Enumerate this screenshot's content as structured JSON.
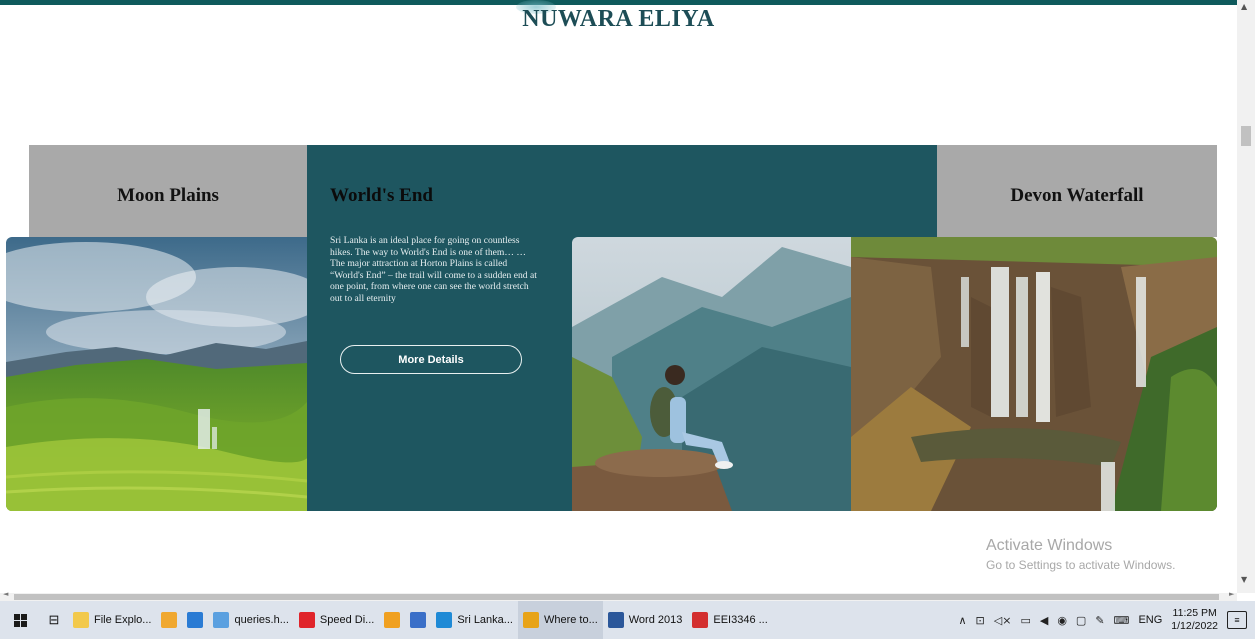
{
  "site": {
    "title": "NUWARA ELIYA"
  },
  "cards": {
    "left_heading": "Moon Plains",
    "right_heading": "Devon Waterfall"
  },
  "feature": {
    "title": "World's End",
    "description": "Sri Lanka is an ideal place for going on countless hikes. The way to World's End is one of them… … The major attraction at Horton Plains is called “World's End” – the trail will come to a sudden end at one point, from where one can see the world stretch out to all eternity",
    "button_label": "More Details"
  },
  "watermark": {
    "line1": "Activate Windows",
    "line2": "Go to Settings to activate Windows."
  },
  "taskbar": {
    "items": [
      {
        "label": "File Explo...",
        "icon": "folder-icon",
        "color": "#f2c94c"
      },
      {
        "label": "",
        "icon": "store-icon",
        "color": "#f0a830"
      },
      {
        "label": "",
        "icon": "mail-icon",
        "color": "#2a7bd4"
      },
      {
        "label": "queries.h...",
        "icon": "notepad-icon",
        "color": "#5aa0e0"
      },
      {
        "label": "Speed Di...",
        "icon": "opera-icon",
        "color": "#e0242b"
      },
      {
        "label": "",
        "icon": "app-icon",
        "color": "#f0a020"
      },
      {
        "label": "",
        "icon": "remote-icon",
        "color": "#3a6fc8"
      },
      {
        "label": "Sri Lanka...",
        "icon": "vscode-icon",
        "color": "#1f8ad6"
      },
      {
        "label": "Where to...",
        "icon": "chrome-icon",
        "color": "#e8a317"
      },
      {
        "label": "Word 2013",
        "icon": "word-icon",
        "color": "#2b579a"
      },
      {
        "label": "EEI3346 ...",
        "icon": "pdf-icon",
        "color": "#d32f2f"
      }
    ],
    "tray": {
      "language": "ENG",
      "time": "11:25 PM",
      "date": "1/12/2022"
    }
  }
}
